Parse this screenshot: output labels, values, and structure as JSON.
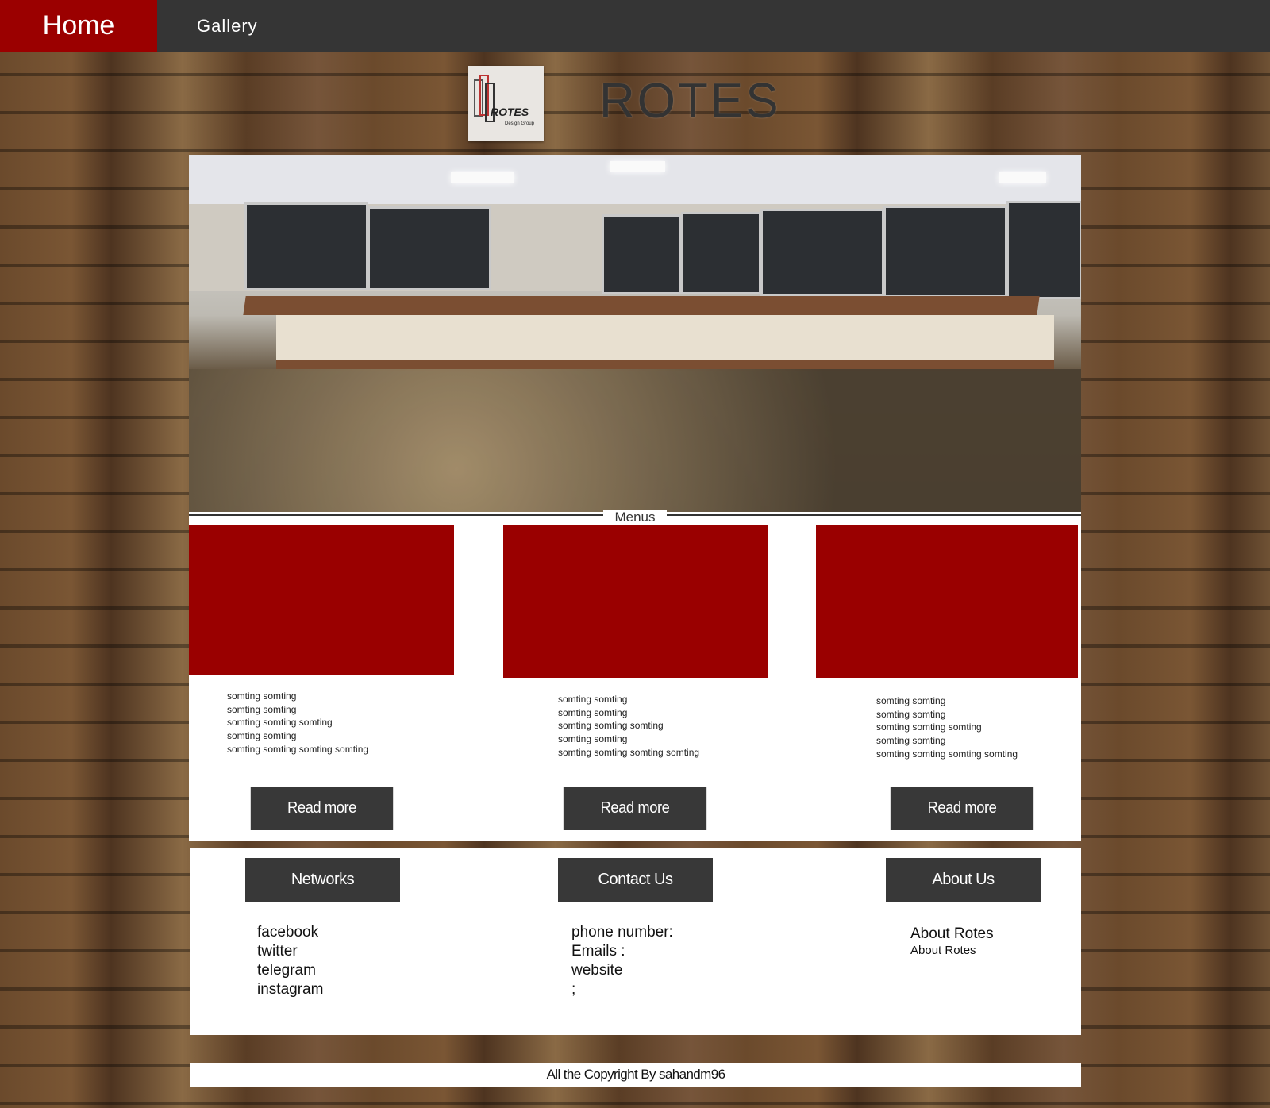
{
  "nav": {
    "home_label": "Home",
    "gallery_label": "Gallery"
  },
  "brand": {
    "logo_text": "ROTES",
    "logo_sub": "Design Group",
    "title": "ROTES"
  },
  "menus": {
    "title": "Menus",
    "cards": [
      {
        "lines": [
          "somting somting",
          "somting somting",
          "somting somting somting",
          "somting somting",
          "somting somting somting somting"
        ],
        "button": "Read more"
      },
      {
        "lines": [
          "somting somting",
          "somting somting",
          "somting somting somting",
          "somting somting",
          "somting somting somting somting"
        ],
        "button": "Read more"
      },
      {
        "lines": [
          "somting somting",
          "somting somting",
          "somting somting somting",
          "somting somting",
          "somting somting somting somting"
        ],
        "button": "Read more"
      }
    ]
  },
  "footer": {
    "networks": {
      "title": "Networks",
      "items": [
        "facebook",
        "twitter",
        "telegram",
        "instagram"
      ]
    },
    "contact": {
      "title": "Contact Us",
      "items": [
        "phone number:",
        "Emails :",
        "website",
        ";"
      ]
    },
    "about": {
      "title": "About Us",
      "items": [
        "About Rotes",
        "About Rotes"
      ]
    }
  },
  "copyright": "All the Copyright By sahandm96",
  "colors": {
    "accent": "#9b0000",
    "dark": "#383838",
    "topbar": "#353535"
  }
}
